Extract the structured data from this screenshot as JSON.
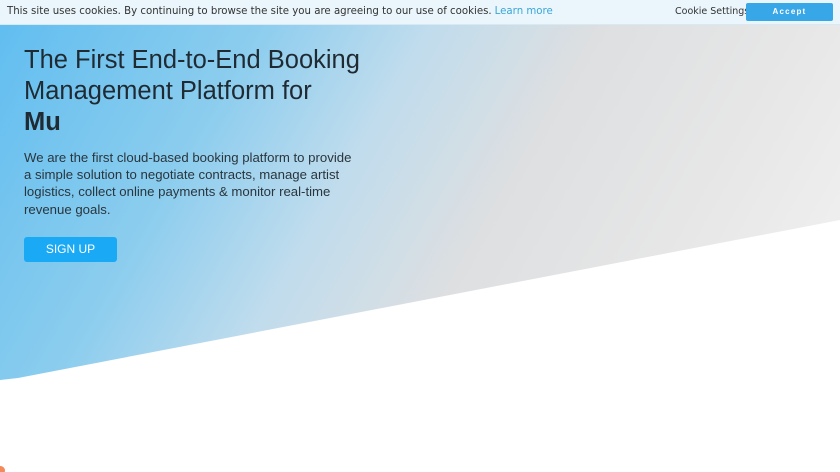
{
  "cookie_banner": {
    "message": "This site uses cookies. By continuing to browse the site you are agreeing to our use of cookies.",
    "learn_more": "Learn more",
    "settings_label": "Cookie Settings",
    "accept_label": "Accept"
  },
  "hero": {
    "title_line_1": "The First End-to-End Booking",
    "title_line_2": "Management Platform for",
    "title_highlight": "Mu",
    "description": "We are the first cloud-based booking platform to provide a simple solution to negotiate contracts, manage artist logistics, collect online payments & monitor real-time revenue goals.",
    "signup_label": "SIGN UP"
  },
  "colors": {
    "accent": "#1aaaf5",
    "cookie_bar": "#eaf6fc",
    "gradient_start": "#5fbdf0",
    "gradient_end": "#f3f3f3"
  }
}
